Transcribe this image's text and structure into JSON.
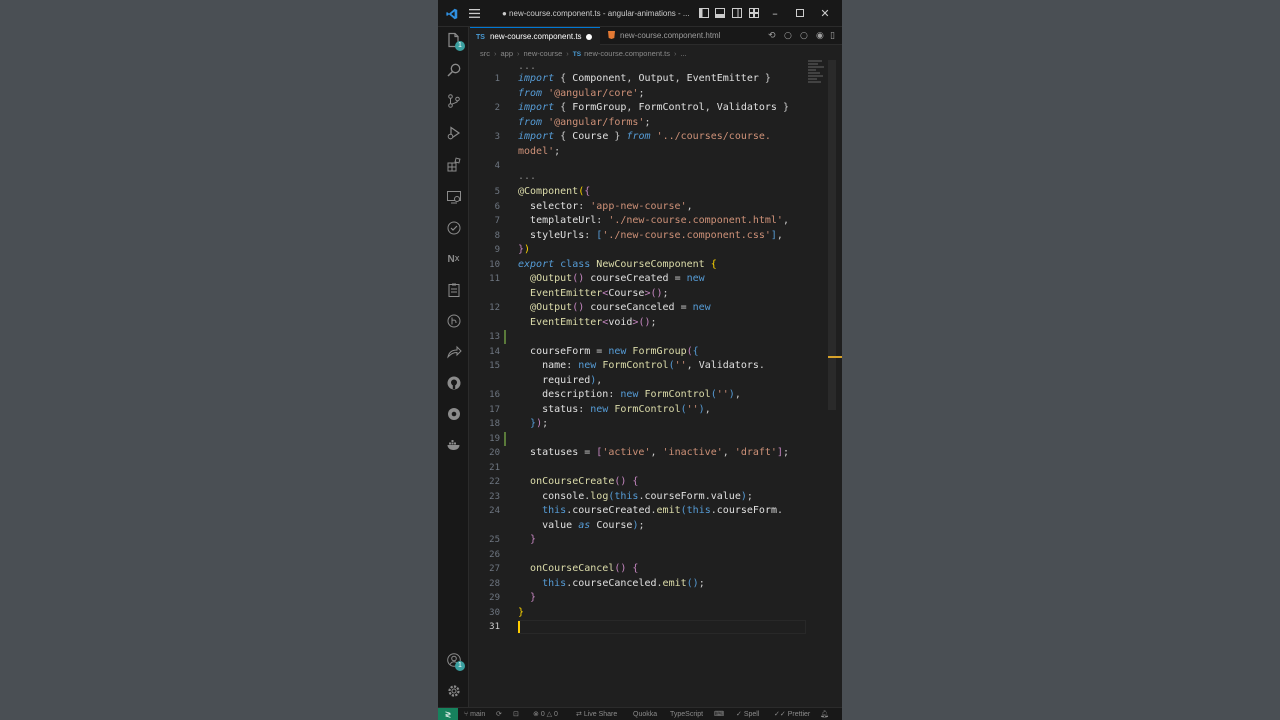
{
  "window": {
    "title": "● new-course.component.ts - angular-animations - ..."
  },
  "tabs": [
    {
      "type": "TS",
      "label": "new-course.component.ts",
      "modified": true
    },
    {
      "type": "HTML",
      "label": "new-course.component.html",
      "modified": false
    }
  ],
  "breadcrumb": [
    "src",
    "app",
    "new-course",
    "TS",
    "new-course.component.ts",
    "..."
  ],
  "editor": {
    "current_line": 31,
    "language": "TypeScript"
  },
  "icons": {
    "activity": [
      "explorer-icon",
      "search-icon",
      "source-control-icon",
      "run-debug-icon",
      "extensions-icon",
      "remote-explorer-icon",
      "testing-icon",
      "nx-icon",
      "clipboard-icon",
      "git-graph-icon",
      "live-share-icon",
      "github-icon",
      "settings-sync-icon",
      "docker-icon",
      "accounts-icon",
      "gear-icon"
    ]
  },
  "explorer_badge": "1",
  "accounts_badge": "1",
  "statusbar": {
    "branch": "main",
    "errors": "0",
    "warnings": "0",
    "live_share": "Live Share",
    "quokka": "Quokka",
    "language": "TypeScript",
    "spell": "Spell",
    "prettier": "Prettier"
  },
  "colors": {
    "accent": "#0078d4",
    "remote": "#16825d",
    "background": "#1f1f1f"
  }
}
